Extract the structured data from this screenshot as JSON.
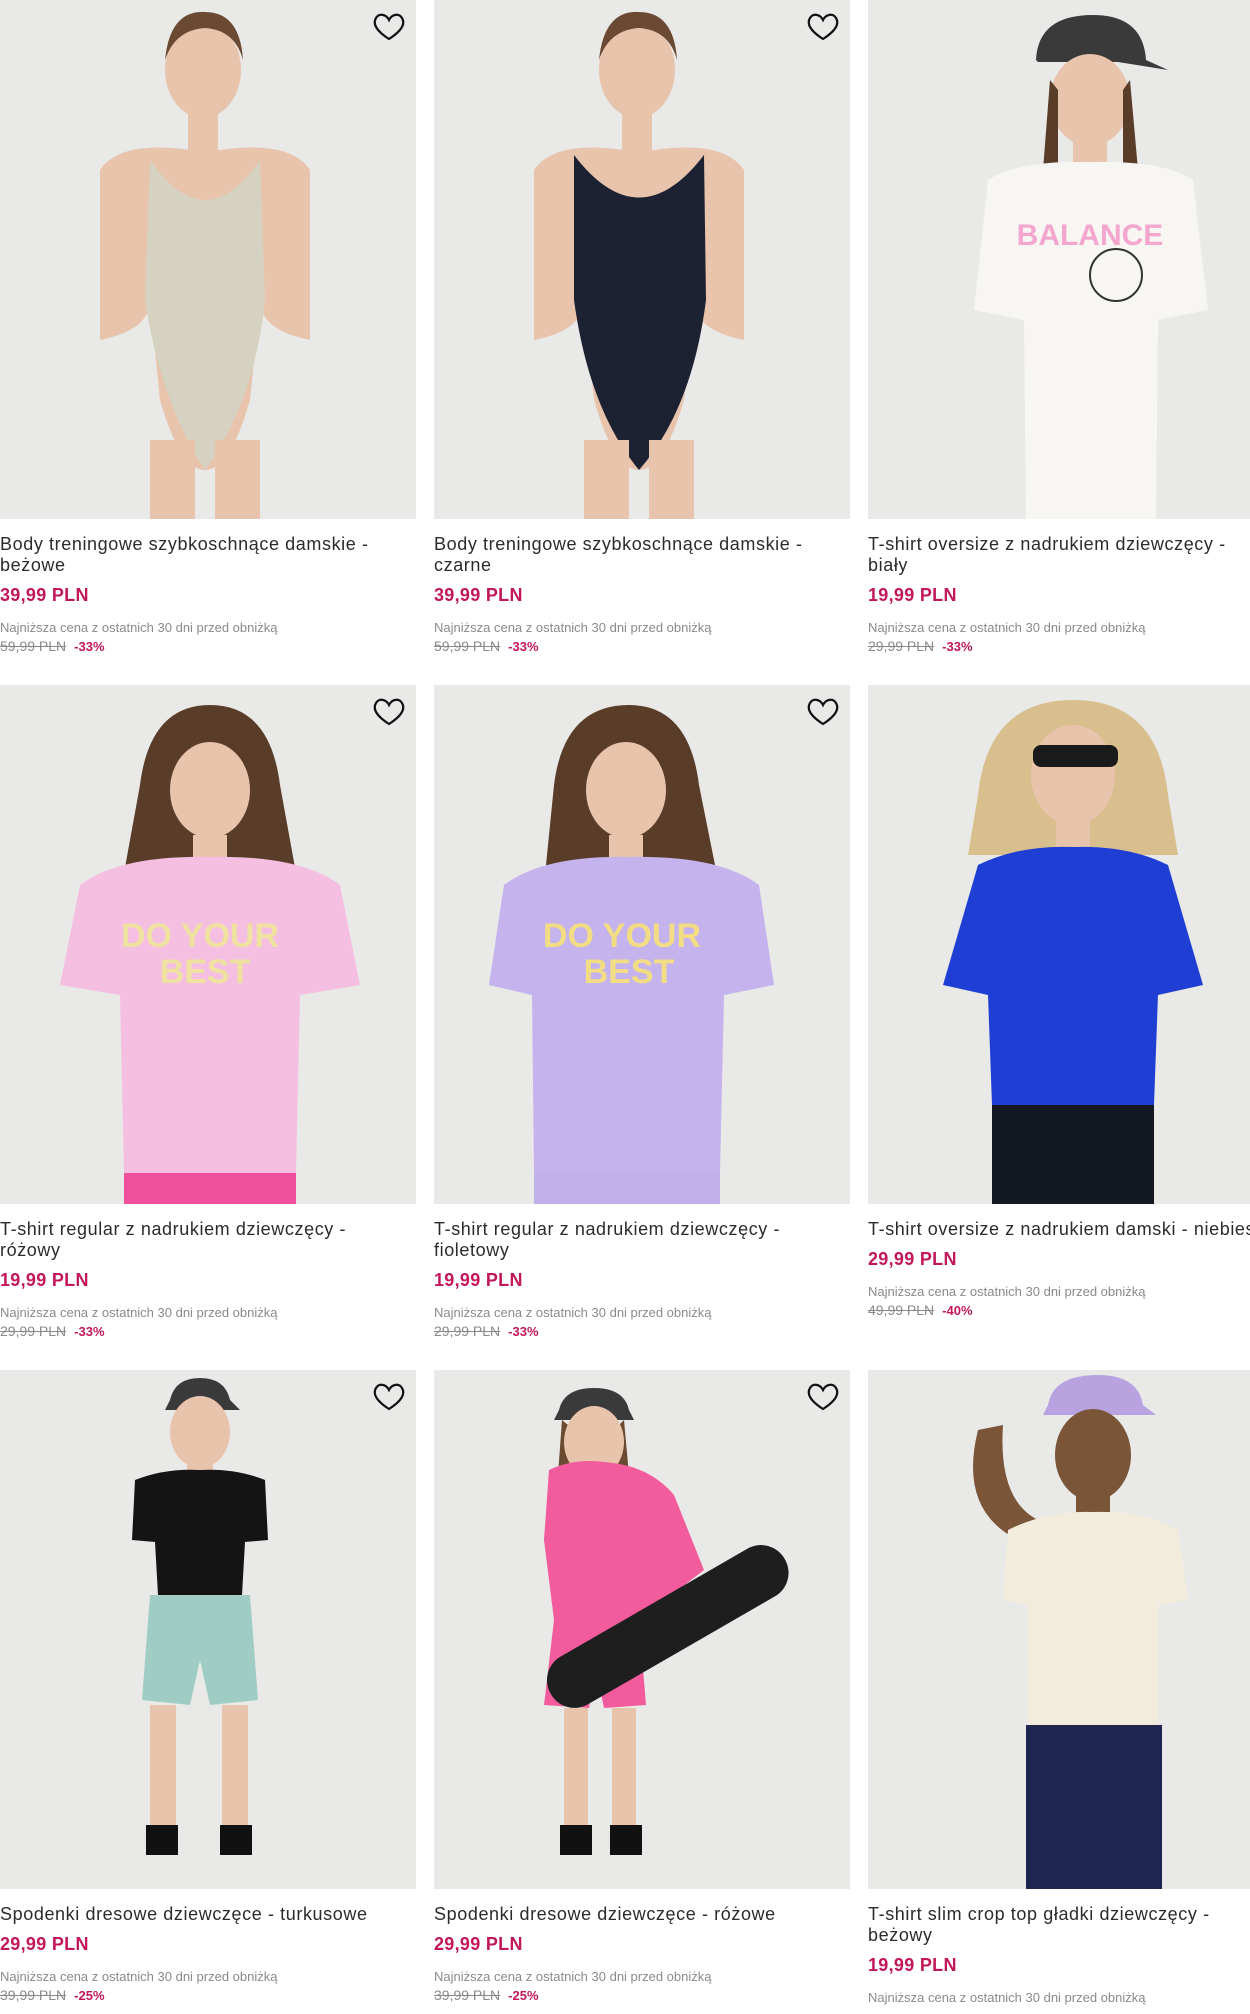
{
  "products": [
    {
      "title": "Body treningowe szybkoschnące damskie -\nbeżowe",
      "price": "39,99 PLN",
      "lowest_label": "Najniższa cena z ostatnich 30 dni przed obniżką",
      "old_price": "59,99 PLN",
      "discount": "-33%",
      "fav_icon": "heart-outline-icon",
      "garment_color": "#d6d2c2",
      "background_color": "#e9e9e8"
    },
    {
      "title": "Body treningowe szybkoschnące damskie -\nczarne",
      "price": "39,99 PLN",
      "lowest_label": "Najniższa cena z ostatnich 30 dni przed obniżką",
      "old_price": "59,99 PLN",
      "discount": "-33%",
      "fav_icon": "heart-outline-icon",
      "garment_color": "#1d2233",
      "background_color": "#e9e9e8"
    },
    {
      "title": "T-shirt oversize z nadrukiem dziewczęcy -\nbiały",
      "price": "19,99 PLN",
      "lowest_label": "Najniższa cena z ostatnich 30 dni przed obniżką",
      "old_price": "29,99 PLN",
      "discount": "-33%",
      "fav_icon": "heart-outline-icon",
      "garment_color": "#f7f6f3",
      "background_color": "#e9e9e8"
    },
    {
      "title": "T-shirt regular z nadrukiem dziewczęcy -\nróżowy",
      "price": "19,99 PLN",
      "lowest_label": "Najniższa cena z ostatnich 30 dni przed obniżką",
      "old_price": "29,99 PLN",
      "discount": "-33%",
      "fav_icon": "heart-outline-icon",
      "garment_color": "#f4bfe0",
      "background_color": "#e9e9e8"
    },
    {
      "title": "T-shirt regular z nadrukiem dziewczęcy -\nfioletowy",
      "price": "19,99 PLN",
      "lowest_label": "Najniższa cena z ostatnich 30 dni przed obniżką",
      "old_price": "29,99 PLN",
      "discount": "-33%",
      "fav_icon": "heart-outline-icon",
      "garment_color": "#c4b3ec",
      "background_color": "#e9e9e8"
    },
    {
      "title": "T-shirt oversize z nadrukiem damski - niebieski",
      "price": "29,99 PLN",
      "lowest_label": "Najniższa cena z ostatnich 30 dni przed obniżką",
      "old_price": "49,99 PLN",
      "discount": "-40%",
      "fav_icon": "heart-outline-icon",
      "garment_color": "#1f3fd4",
      "background_color": "#e9e9e8"
    },
    {
      "title": "Spodenki dresowe dziewczęce - turkusowe",
      "price": "29,99 PLN",
      "lowest_label": "Najniższa cena z ostatnich 30 dni przed obniżką",
      "old_price": "39,99 PLN",
      "discount": "-25%",
      "fav_icon": "heart-outline-icon",
      "garment_color": "#9fcdc4",
      "background_color": "#e9e9e8"
    },
    {
      "title": "Spodenki dresowe dziewczęce - różowe",
      "price": "29,99 PLN",
      "lowest_label": "Najniższa cena z ostatnich 30 dni przed obniżką",
      "old_price": "39,99 PLN",
      "discount": "-25%",
      "fav_icon": "heart-outline-icon",
      "garment_color": "#f25c9c",
      "background_color": "#e9e9e8"
    },
    {
      "title": "T-shirt slim crop top gładki dziewczęcy -\nbeżowy",
      "price": "19,99 PLN",
      "lowest_label": "Najniższa cena z ostatnich 30 dni przed obniżką",
      "old_price": "",
      "discount": "",
      "fav_icon": "heart-outline-icon",
      "garment_color": "#f1ecdc",
      "background_color": "#e9e9e8"
    }
  ],
  "colors": {
    "sale_price": "#c2185b",
    "text": "#2b2b2b",
    "muted": "#8a8a8a"
  }
}
